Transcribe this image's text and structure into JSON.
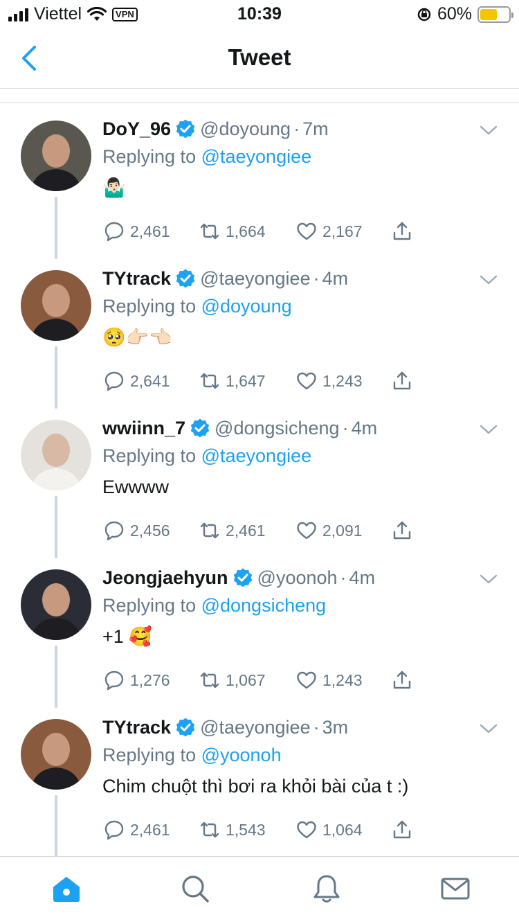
{
  "status_bar": {
    "carrier": "Viettel",
    "vpn": "VPN",
    "time": "10:39",
    "battery": "60%",
    "battery_level": 0.6
  },
  "nav": {
    "title": "Tweet"
  },
  "tweets": [
    {
      "name": "DoY_96",
      "handle": "@doyoung",
      "time": "7m",
      "replying_prefix": "Replying to ",
      "replying_to": "@taeyongiee",
      "text": "🤷🏻‍♂️",
      "replies": "2,461",
      "retweets": "1,664",
      "likes": "2,167",
      "avatar_color": "#5a5750"
    },
    {
      "name": "TYtrack",
      "handle": "@taeyongiee",
      "time": "4m",
      "replying_prefix": "Replying to ",
      "replying_to": "@doyoung",
      "text": "🥺👉🏻👈🏻",
      "replies": "2,641",
      "retweets": "1,647",
      "likes": "1,243",
      "avatar_color": "#8a5a3e"
    },
    {
      "name": "wwiinn_7",
      "handle": "@dongsicheng",
      "time": "4m",
      "replying_prefix": "Replying to ",
      "replying_to": "@taeyongiee",
      "text": "Ewwww",
      "replies": "2,456",
      "retweets": "2,461",
      "likes": "2,091",
      "avatar_color": "#e5e2de"
    },
    {
      "name": "Jeongjaehyun",
      "handle": "@yoonoh",
      "time": "4m",
      "replying_prefix": "Replying to ",
      "replying_to": "@dongsicheng",
      "text": "+1 🥰",
      "replies": "1,276",
      "retweets": "1,067",
      "likes": "1,243",
      "avatar_color": "#2a2d36"
    },
    {
      "name": "TYtrack",
      "handle": "@taeyongiee",
      "time": "3m",
      "replying_prefix": "Replying to ",
      "replying_to": "@yoonoh",
      "text": "Chim chuột thì bơi ra khỏi bài của t :)",
      "replies": "2,461",
      "retweets": "1,543",
      "likes": "1,064",
      "avatar_color": "#8a5a3e"
    }
  ],
  "colors": {
    "accent": "#1da1f2",
    "secondary_text": "#657786",
    "thread_line": "#ccd6dd"
  }
}
